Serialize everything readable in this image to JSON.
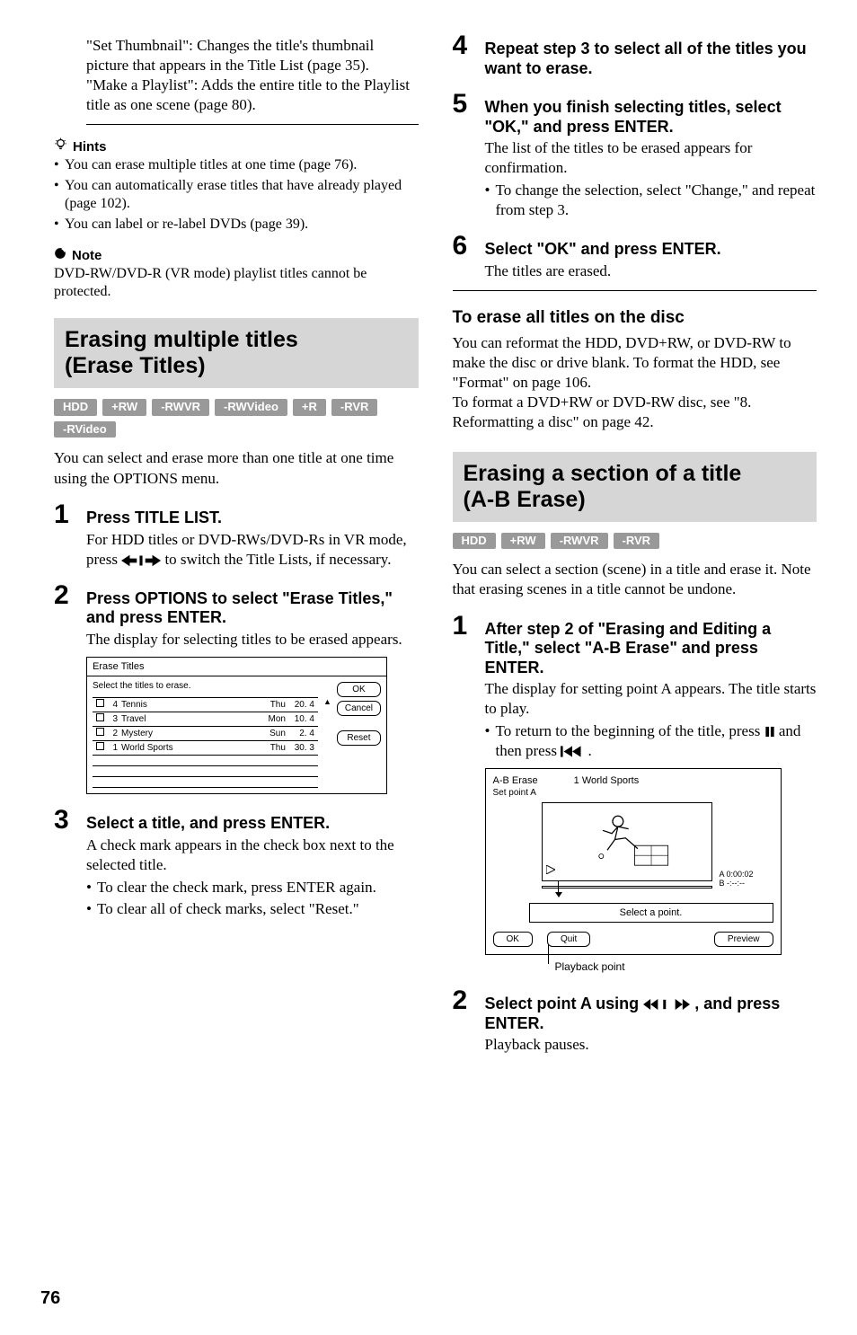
{
  "left": {
    "intro1": "\"Set Thumbnail\": Changes the title's thumbnail picture that appears in the Title List (page 35).",
    "intro2": "\"Make a Playlist\": Adds the entire title to the Playlist title as one scene (page 80).",
    "hints_label": "Hints",
    "hints": [
      "You can erase multiple titles at one time (page 76).",
      "You can automatically erase titles that have already played (page 102).",
      "You can label or re-label DVDs (page 39)."
    ],
    "note_label": "Note",
    "note_text": "DVD-RW/DVD-R (VR mode) playlist titles cannot be protected.",
    "section1_title_l1": "Erasing multiple titles",
    "section1_title_l2": "(Erase Titles)",
    "badges1": [
      "HDD",
      "+RW",
      "-RWVR",
      "-RWVideo",
      "+R",
      "-RVR",
      "-RVideo"
    ],
    "sec1_intro": "You can select and erase more than one title at one time using the OPTIONS menu.",
    "step1_head": "Press TITLE LIST.",
    "step1_body": "For HDD titles or DVD-RWs/DVD-Rs in VR mode, press ",
    "step1_body_tail": " to switch the Title Lists, if necessary.",
    "step2_head": "Press OPTIONS to select \"Erase Titles,\" and press ENTER.",
    "step2_body": "The display for selecting titles to be erased appears.",
    "shot1": {
      "title": "Erase Titles",
      "caption": "Select the titles to erase.",
      "rows": [
        {
          "n": "4",
          "name": "Tennis",
          "day": "Thu",
          "date": "20. 4"
        },
        {
          "n": "3",
          "name": "Travel",
          "day": "Mon",
          "date": "10. 4"
        },
        {
          "n": "2",
          "name": "Mystery",
          "day": "Sun",
          "date": "2. 4"
        },
        {
          "n": "1",
          "name": "World Sports",
          "day": "Thu",
          "date": "30. 3"
        }
      ],
      "buttons": {
        "ok": "OK",
        "cancel": "Cancel",
        "reset": "Reset"
      }
    },
    "step3_head": "Select a title, and press ENTER.",
    "step3_body": "A check mark appears in the check box next to the selected title.",
    "step3_bullets": [
      "To clear the check mark, press ENTER again.",
      "To clear all of check marks, select \"Reset.\""
    ]
  },
  "right": {
    "step4_head": "Repeat step 3 to select all of the titles you want to erase.",
    "step5_head": "When you finish selecting titles, select \"OK,\" and press ENTER.",
    "step5_body": "The list of the titles to be erased appears for confirmation.",
    "step5_bullets": [
      "To change the selection, select \"Change,\" and repeat from step 3."
    ],
    "step6_head": "Select \"OK\" and press ENTER.",
    "step6_body": "The titles are erased.",
    "sub1_head": "To erase all titles on the disc",
    "sub1_body1": "You can reformat the HDD, DVD+RW, or DVD-RW to make the disc or drive blank. To format the HDD, see \"Format\" on page 106.",
    "sub1_body2": "To format a DVD+RW or DVD-RW disc, see \"8. Reformatting a disc\" on page 42.",
    "section2_title_l1": "Erasing a section of a title",
    "section2_title_l2": "(A-B Erase)",
    "badges2": [
      "HDD",
      "+RW",
      "-RWVR",
      "-RVR"
    ],
    "sec2_intro": "You can select a section (scene) in a title and erase it. Note that erasing scenes in a title cannot be undone.",
    "r_step1_head": "After step 2 of \"Erasing and Editing a Title,\" select \"A-B Erase\" and press ENTER.",
    "r_step1_body": "The display for setting point A appears. The title starts to play.",
    "r_step1_bullet_pre": "To return to the beginning of the title, press ",
    "r_step1_bullet_mid": " and then press ",
    "r_step1_bullet_post": ".",
    "shot2": {
      "title_l": "A-B Erase",
      "title_l2": "Set point A",
      "title_r": "1 World Sports",
      "time_a": "A 0:00:02",
      "time_b": "B -:--:--",
      "select": "Select a point.",
      "ok": "OK",
      "quit": "Quit",
      "preview": "Preview"
    },
    "callout": "Playback point",
    "r_step2_head_pre": "Select point A using ",
    "r_step2_head_post": ", and press ENTER.",
    "r_step2_body": "Playback pauses."
  },
  "page": "76"
}
